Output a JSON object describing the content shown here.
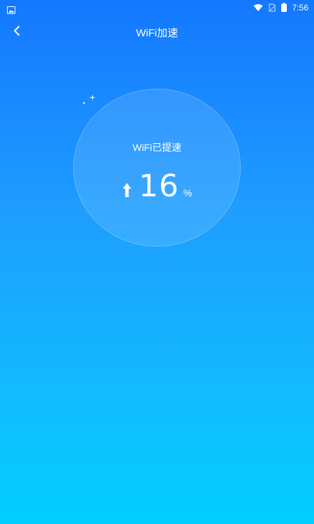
{
  "status_bar": {
    "time": "7:56",
    "icons": [
      "image-icon",
      "wifi-icon",
      "sim-icon",
      "battery-icon"
    ]
  },
  "header": {
    "back_icon": "chevron-left-icon",
    "title": "WiFi加速"
  },
  "speed_panel": {
    "label": "WiFi已提速",
    "value": "16",
    "unit": "%",
    "arrow_icon": "up-arrow-icon"
  },
  "colors": {
    "gradient_top": "#1478ff",
    "gradient_bottom": "#00cfff",
    "text": "#ffffff"
  }
}
